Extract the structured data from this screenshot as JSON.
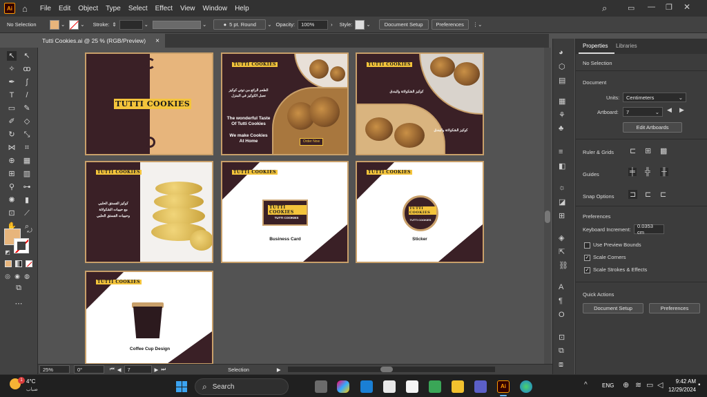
{
  "app": {
    "logo": "Ai",
    "menu": [
      "File",
      "Edit",
      "Object",
      "Type",
      "Select",
      "Effect",
      "View",
      "Window",
      "Help"
    ]
  },
  "control_bar": {
    "selection": "No Selection",
    "fill_color": "#e7b57c",
    "stroke_label": "Stroke:",
    "brush": "5 pt. Round",
    "opacity_label": "Opacity:",
    "opacity_value": "100%",
    "style_label": "Style:",
    "document_setup": "Document Setup",
    "preferences": "Preferences"
  },
  "document_tab": {
    "title": "Tutti Cookies.ai @ 25 % (RGB/Preview)",
    "close": "×"
  },
  "brand": {
    "name_a": "TUTTI",
    "name_b": "COOKIES",
    "colors": {
      "dark": "#3a2026",
      "tan": "#e7b57c",
      "gold": "#f4c43b"
    }
  },
  "artboards": {
    "ab2": {
      "arabic_1": "الطعم الرائع من توتي كوكيز",
      "arabic_2": "نعمل الكوكيز في المنزل",
      "line1": "The wonderful Taste",
      "line2": "Of Tutti Cookies",
      "line3": "We make Cookies",
      "line4": "At Home",
      "button": "Order Now"
    },
    "ab3": {
      "arabic_1": "كوكيز الشكولاتة والبندق",
      "arabic_2": "كوكيز الشكولاتة والبندق"
    },
    "ab4": {
      "arabic_1": "كوكيز الفستق الحلبي",
      "arabic_2": "مع حبيبات الشكولاتة",
      "arabic_3": "وحبيبات الفستق الحلبي"
    },
    "ab5": {
      "caption": "Business Card",
      "card_sub": "TUTTI COOKIES"
    },
    "ab6": {
      "caption": "Sticker",
      "sticker_sub": "TUTTI COOKIES"
    },
    "ab7": {
      "caption": "Coffee Cup Design"
    }
  },
  "properties_panel": {
    "tab_properties": "Properties",
    "tab_libraries": "Libraries",
    "no_selection": "No Selection",
    "document": "Document",
    "units_label": "Units:",
    "units_value": "Centimeters",
    "artboard_label": "Artboard:",
    "artboard_value": "7",
    "edit_artboards": "Edit Artboards",
    "rulers_grids": "Ruler & Grids",
    "guides": "Guides",
    "snap_options": "Snap Options",
    "preferences": "Preferences",
    "keyboard_increment_label": "Keyboard Increment:",
    "keyboard_increment_value": "0.0353 cm",
    "use_preview_bounds": "Use Preview Bounds",
    "scale_corners": "Scale Corners",
    "scale_strokes": "Scale Strokes & Effects",
    "quick_actions": "Quick Actions",
    "document_setup": "Document Setup",
    "preferences_button": "Preferences"
  },
  "status_bar": {
    "zoom": "25%",
    "rotation": "0°",
    "artboard": "7",
    "mode": "Selection"
  },
  "taskbar": {
    "weather_temp": "4°C",
    "weather_desc": "ضباب",
    "weather_badge": "1",
    "search": "Search",
    "language": "ENG",
    "time": "9:42 AM",
    "date": "12/29/2024"
  }
}
